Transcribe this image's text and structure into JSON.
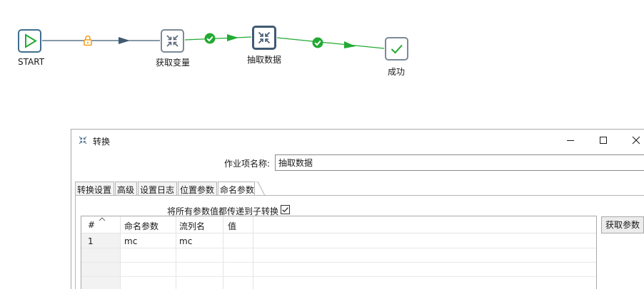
{
  "workflow": {
    "nodes": [
      {
        "id": "start",
        "label": "START",
        "icon": "play-icon"
      },
      {
        "id": "getvar",
        "label": "获取变量",
        "icon": "collapse-arrows-icon"
      },
      {
        "id": "extract",
        "label": "抽取数据",
        "icon": "collapse-arrows-icon",
        "selected": true
      },
      {
        "id": "success",
        "label": "成功",
        "icon": "checkmark-icon"
      }
    ],
    "hops": [
      {
        "from": "start",
        "to": "getvar",
        "type": "unconditional",
        "icon": "lock-icon",
        "color": "#3f5a73"
      },
      {
        "from": "getvar",
        "to": "extract",
        "type": "success",
        "icon": "check-circle-icon",
        "color": "#22aa33"
      },
      {
        "from": "extract",
        "to": "success",
        "type": "success",
        "icon": "check-circle-icon",
        "color": "#22aa33"
      }
    ]
  },
  "dialog": {
    "title": "转换",
    "title_icon": "transformation-icon",
    "controls": {
      "minimize": "minimize-icon",
      "maximize": "maximize-icon",
      "close": "close-icon"
    },
    "job_name_label": "作业项名称:",
    "job_name_value": "抽取数据",
    "tabs": [
      {
        "label": "转换设置",
        "active": false
      },
      {
        "label": "高级",
        "active": false
      },
      {
        "label": "设置日志",
        "active": false
      },
      {
        "label": "位置参数",
        "active": false
      },
      {
        "label": "命名参数",
        "active": true
      }
    ],
    "pass_all_label": "将所有参数值都传递到子转换",
    "pass_all_checked": true,
    "table": {
      "columns": [
        "#",
        "命名参数",
        "流列名",
        "值"
      ],
      "rows": [
        [
          "1",
          "mc",
          "mc",
          ""
        ]
      ]
    },
    "fetch_button": "获取参数"
  },
  "colors": {
    "success_hop": "#22aa33",
    "default_hop": "#3f5a73",
    "lock": "#f0a020"
  }
}
